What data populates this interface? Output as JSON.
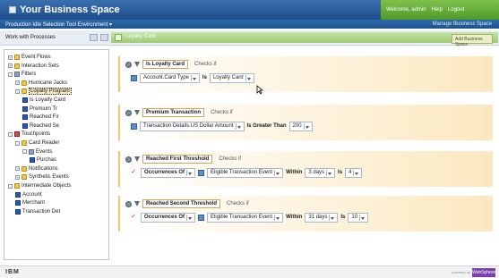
{
  "window": {
    "title": "Your Business Space",
    "user_links": [
      "Welcome, admin",
      "Help",
      "Logout"
    ]
  },
  "subbar": {
    "environment": "Production Idle Selection Tool Environment ▾",
    "right_text": "Manage Business Space"
  },
  "toolbar": {
    "processes_label": "Work with Processes",
    "strip_label": "Loyalty Card",
    "right_button": "Add Business Space"
  },
  "tree": [
    {
      "label": "Event Flows",
      "level": 0,
      "kind": "folder",
      "exp": "+"
    },
    {
      "label": "Interaction Sets",
      "level": 0,
      "kind": "folder",
      "exp": "+"
    },
    {
      "label": "Filters",
      "level": 0,
      "kind": "filter",
      "exp": "-"
    },
    {
      "label": "Hurricane Jacks",
      "level": 1,
      "kind": "folder",
      "exp": "+"
    },
    {
      "label": "Loyalty Program",
      "level": 1,
      "kind": "folder",
      "exp": "-",
      "selected": true
    },
    {
      "label": "Is Loyalty Card",
      "level": 2,
      "kind": "item"
    },
    {
      "label": "Premium Tr",
      "level": 2,
      "kind": "item"
    },
    {
      "label": "Reached Fir",
      "level": 2,
      "kind": "item"
    },
    {
      "label": "Reached Se",
      "level": 2,
      "kind": "item"
    },
    {
      "label": "Touchpoints",
      "level": 0,
      "kind": "touch",
      "exp": "-"
    },
    {
      "label": "Card Reader",
      "level": 1,
      "kind": "folder",
      "exp": "-"
    },
    {
      "label": "Events",
      "level": 2,
      "kind": "wrench",
      "exp": "-"
    },
    {
      "label": "Purchas",
      "level": 3,
      "kind": "item"
    },
    {
      "label": "Notifications",
      "level": 1,
      "kind": "folder",
      "exp": "+"
    },
    {
      "label": "Synthetic Events",
      "level": 1,
      "kind": "folder",
      "exp": "+"
    },
    {
      "label": "Intermediate Objects",
      "level": 0,
      "kind": "folder",
      "exp": "-"
    },
    {
      "label": "Account",
      "level": 1,
      "kind": "item"
    },
    {
      "label": "Merchant",
      "level": 1,
      "kind": "item"
    },
    {
      "label": "Transaction Det",
      "level": 1,
      "kind": "item"
    }
  ],
  "filters": [
    {
      "name": "Is Loyalty Card",
      "meta": "Checks if",
      "row": {
        "field": "Account.Card Type",
        "operator": "Is",
        "value": "Loyalty Card"
      }
    },
    {
      "name": "Premium Transaction",
      "meta": "Checks if",
      "row": {
        "field": "Transaction Details.US Dollar Amount",
        "operator": "Is Greater Than",
        "value": "200"
      }
    },
    {
      "name": "Reached First Threshold",
      "meta": "Checks if",
      "row": {
        "func": "Occurrences Of",
        "field": "Eligible Transaction Event",
        "within_label": "Within",
        "period": "3 days",
        "operator": "Is",
        "value": "4"
      }
    },
    {
      "name": "Reached Second Threshold",
      "meta": "Checks if",
      "row": {
        "func": "Occurrences Of",
        "field": "Eligible Transaction Event",
        "within_label": "Within",
        "period": "31 days",
        "operator": "Is",
        "value": "10"
      }
    }
  ],
  "footer": {
    "brand": "IBM",
    "powered": "powered by",
    "corner": "WebSphere"
  },
  "colors": {
    "title_bar": "#1f4e8c",
    "accent_green": "#7ec14a",
    "filter_block": "#fbe8bf"
  }
}
